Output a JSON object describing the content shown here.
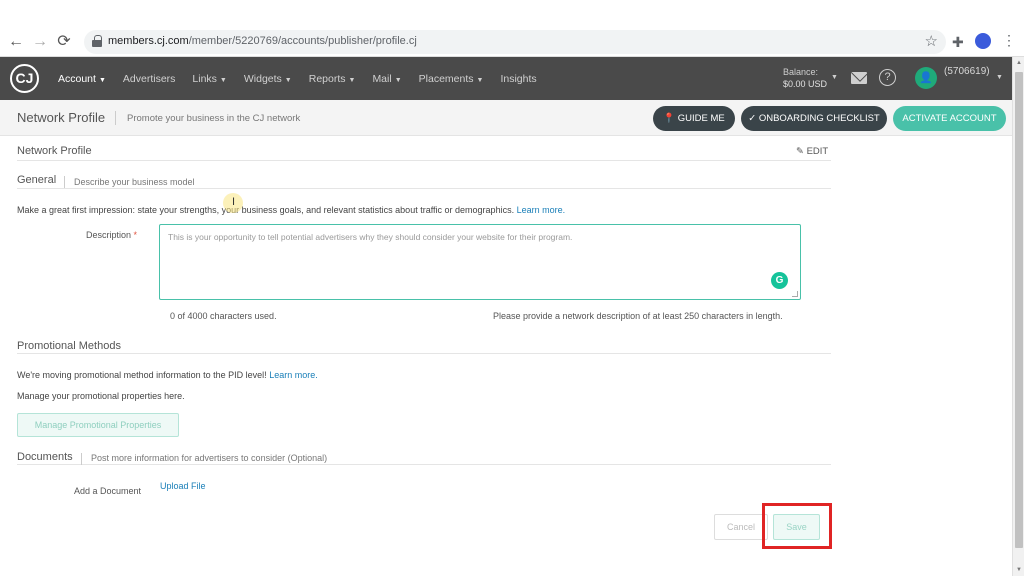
{
  "browser": {
    "url_host": "members.cj.com",
    "url_path": "/member/5220769/accounts/publisher/profile.cj",
    "back_icon": "←",
    "forward_icon": "→",
    "reload_icon": "⟳",
    "star_icon": "☆",
    "extensions_icon": "✚",
    "menu_icon": "⋮"
  },
  "header": {
    "logo_text": "CJ",
    "nav": [
      {
        "label": "Account",
        "has_caret": true,
        "active": true
      },
      {
        "label": "Advertisers",
        "has_caret": false
      },
      {
        "label": "Links",
        "has_caret": true
      },
      {
        "label": "Widgets",
        "has_caret": true
      },
      {
        "label": "Reports",
        "has_caret": true
      },
      {
        "label": "Mail",
        "has_caret": true
      },
      {
        "label": "Placements",
        "has_caret": true
      },
      {
        "label": "Insights",
        "has_caret": false
      }
    ],
    "caret_glyph": "▼",
    "balance_label": "Balance:",
    "balance_amount": "$0.00 USD",
    "help_glyph": "?",
    "user_icon_glyph": "👤",
    "user_id": "(5706619)"
  },
  "title_bar": {
    "title": "Network Profile",
    "subtitle": "Promote your business in the CJ network",
    "guide_me": "📍 GUIDE ME",
    "onboarding": "✓ ONBOARDING CHECKLIST",
    "activate": "ACTIVATE ACCOUNT"
  },
  "profile": {
    "heading": "Network Profile",
    "edit_label": "✎ EDIT"
  },
  "general": {
    "title": "General",
    "subtitle": "Describe your business model",
    "intro": "Make a great first impression: state your strengths, your business goals, and relevant statistics about traffic or demographics.",
    "learn_more": "Learn more.",
    "description_label": "Description",
    "required_mark": "*",
    "description_placeholder": "This is your opportunity to tell potential advertisers why they should consider your website for their program.",
    "grammarly_glyph": "G",
    "char_count": "0 of 4000 characters used.",
    "char_hint": "Please provide a network description of at least 250 characters in length."
  },
  "promotional": {
    "title": "Promotional Methods",
    "notice": "We're moving promotional method information to the PID level!",
    "learn_more": "Learn more.",
    "manage_text": "Manage your promotional properties here.",
    "manage_button": "Manage Promotional Properties"
  },
  "documents": {
    "title": "Documents",
    "subtitle": "Post more information for advertisers to consider (Optional)",
    "add_label": "Add a Document",
    "upload_link": "Upload File"
  },
  "actions": {
    "cancel": "Cancel",
    "save": "Save"
  },
  "colors": {
    "header_bg": "#4a4a4a",
    "accent_teal": "#49c1a9",
    "dark_button": "#3a4449",
    "link": "#1a7fb8",
    "highlight": "#e02424"
  }
}
